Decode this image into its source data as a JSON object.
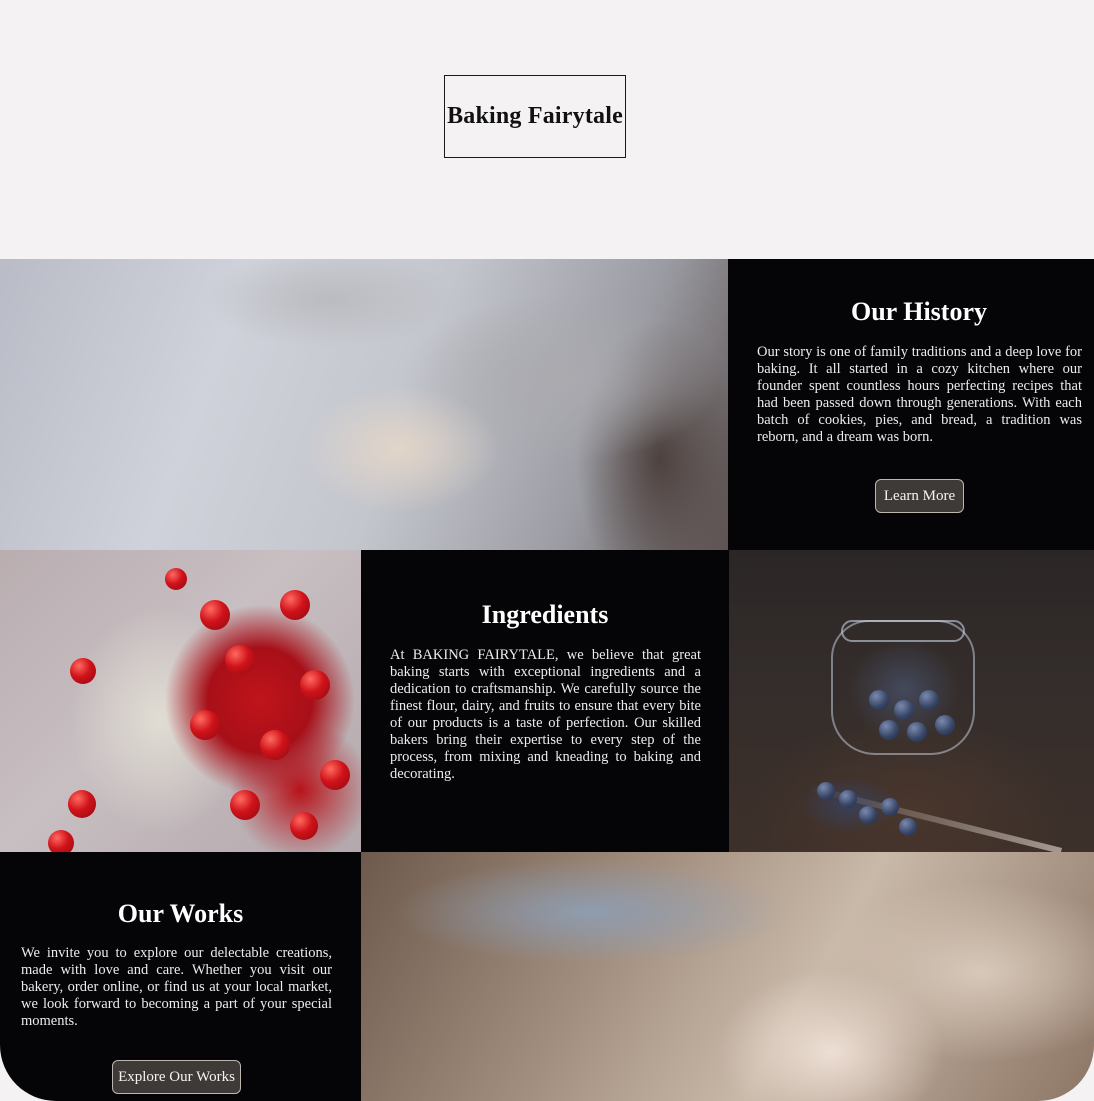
{
  "header": {
    "logo_text": "Baking Fairytale"
  },
  "history": {
    "title": "Our History",
    "body": "Our story is one of family traditions and a deep love for baking. It all started in a cozy kitchen where our founder spent countless hours perfecting recipes that had been passed down through generations. With each batch of cookies, pies, and bread, a tradition was reborn, and a dream was born.",
    "button_label": "Learn More"
  },
  "ingredients": {
    "title": "Ingredients",
    "body": "At BAKING FAIRYTALE, we believe that great baking starts with exceptional ingredients and a dedication to craftsmanship. We carefully source the finest flour, dairy, and fruits to ensure that every bite of our products is a taste of perfection. Our skilled bakers bring their expertise to every step of the process, from mixing and kneading to baking and decorating."
  },
  "works": {
    "title": "Our Works",
    "body": "We invite you to explore our delectable creations, made with love and care. Whether you visit our bakery, order online, or find us at your local market, we look forward to becoming a part of your special moments.",
    "button_label": "Explore Our Works"
  },
  "colors": {
    "page_background": "#f4f2f3",
    "panel_background": "#050507",
    "button_background": "#3e3a37"
  }
}
